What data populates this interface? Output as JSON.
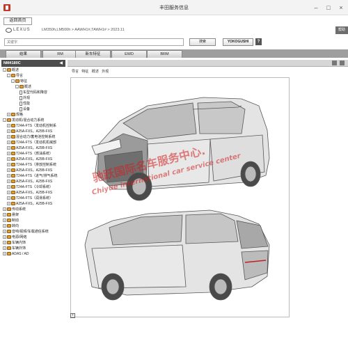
{
  "window": {
    "title": "丰田服务信息",
    "min_icon": "minimize-icon",
    "max_icon": "maximize-icon",
    "close_icon": "close-icon"
  },
  "header": {
    "back_label": "返回首页",
    "brand": "LEXUS",
    "breadcrumb": "LM350h,LM500h > AAWH1#,TAWH1# > 2023.11",
    "help_label": "帮助"
  },
  "search": {
    "placeholder": "关键字",
    "search_label": "搜索",
    "yokogushi_label": "YOKOGUSHI",
    "help_label": "?"
  },
  "tabs": [
    "结果",
    "RM",
    "新车特征",
    "EWD",
    "BRM"
  ],
  "sidebar": {
    "header": "NM4180C",
    "items": [
      {
        "label": "概述",
        "level": 1,
        "type": "book",
        "exp": "-"
      },
      {
        "label": "导言",
        "level": 2,
        "type": "book",
        "exp": "-"
      },
      {
        "label": "特征",
        "level": 3,
        "type": "book",
        "exp": "-"
      },
      {
        "label": "概述",
        "level": 4,
        "type": "book",
        "exp": "-"
      },
      {
        "label": "车型代码和降容",
        "level": 5,
        "type": "doc",
        "exp": ""
      },
      {
        "label": "外观",
        "level": 5,
        "type": "doc",
        "exp": ""
      },
      {
        "label": "性能",
        "level": 5,
        "type": "doc",
        "exp": ""
      },
      {
        "label": "设备",
        "level": 5,
        "type": "doc",
        "exp": ""
      },
      {
        "label": "规格",
        "level": 2,
        "type": "book",
        "exp": "+"
      },
      {
        "label": "发动机/混合动力系统",
        "level": 1,
        "type": "book",
        "exp": "-"
      },
      {
        "label": "T24A-FTS（发动机控制系",
        "level": 2,
        "type": "book",
        "exp": "+"
      },
      {
        "label": "A25A-FXS，A25B-FXS",
        "level": 2,
        "type": "book",
        "exp": "+"
      },
      {
        "label": "混合动力/蓄电池控制系统",
        "level": 2,
        "type": "book",
        "exp": "+"
      },
      {
        "label": "T24A-FTS（发动机机械部",
        "level": 2,
        "type": "book",
        "exp": "+"
      },
      {
        "label": "A25A-FXS，A25B-FXS",
        "level": 2,
        "type": "book",
        "exp": "+"
      },
      {
        "label": "T24A-FTS（燃油系统）",
        "level": 2,
        "type": "book",
        "exp": "+"
      },
      {
        "label": "A25A-FXS，A25B-FXS",
        "level": 2,
        "type": "book",
        "exp": "+"
      },
      {
        "label": "T24A-FTS（排放控制系统",
        "level": 2,
        "type": "book",
        "exp": "+"
      },
      {
        "label": "A25A-FXS，A25B-FXS",
        "level": 2,
        "type": "book",
        "exp": "+"
      },
      {
        "label": "T24A-FTS（进气/排气系统",
        "level": 2,
        "type": "book",
        "exp": "+"
      },
      {
        "label": "A25A-FXS，A25B-FXS",
        "level": 2,
        "type": "book",
        "exp": "+"
      },
      {
        "label": "T24A-FTS（冷却系统）",
        "level": 2,
        "type": "book",
        "exp": "+"
      },
      {
        "label": "A25A-FXS，A25B-FXS",
        "level": 2,
        "type": "book",
        "exp": "+"
      },
      {
        "label": "T24A-FTS（润滑系统）",
        "level": 2,
        "type": "book",
        "exp": "+"
      },
      {
        "label": "A25A-FXS，A25B-FXS",
        "level": 2,
        "type": "book",
        "exp": "+"
      },
      {
        "label": "传动系统",
        "level": 1,
        "type": "book",
        "exp": "+"
      },
      {
        "label": "悬架",
        "level": 1,
        "type": "book",
        "exp": "+"
      },
      {
        "label": "制动",
        "level": 1,
        "type": "book",
        "exp": "+"
      },
      {
        "label": "转向",
        "level": 1,
        "type": "book",
        "exp": "+"
      },
      {
        "label": "音响/视频/车载通信系统",
        "level": 1,
        "type": "book",
        "exp": "+"
      },
      {
        "label": "电源/网络",
        "level": 1,
        "type": "book",
        "exp": "+"
      },
      {
        "label": "车辆内饰",
        "level": 1,
        "type": "book",
        "exp": "+"
      },
      {
        "label": "车辆外饰",
        "level": 1,
        "type": "book",
        "exp": "+"
      },
      {
        "label": "ADAS / AD",
        "level": 1,
        "type": "book",
        "exp": "+"
      }
    ]
  },
  "content": {
    "subtabs": [
      "导言",
      "特征",
      "概述",
      "外观"
    ],
    "watermark_cn": "驰跃国际名车服务中心.",
    "watermark_en": "Chiyue international car service center"
  },
  "colors": {
    "tabbar": "#9e9e9e",
    "sidebar_header": "#4d4d4d",
    "watermark": "#d21e1e"
  }
}
